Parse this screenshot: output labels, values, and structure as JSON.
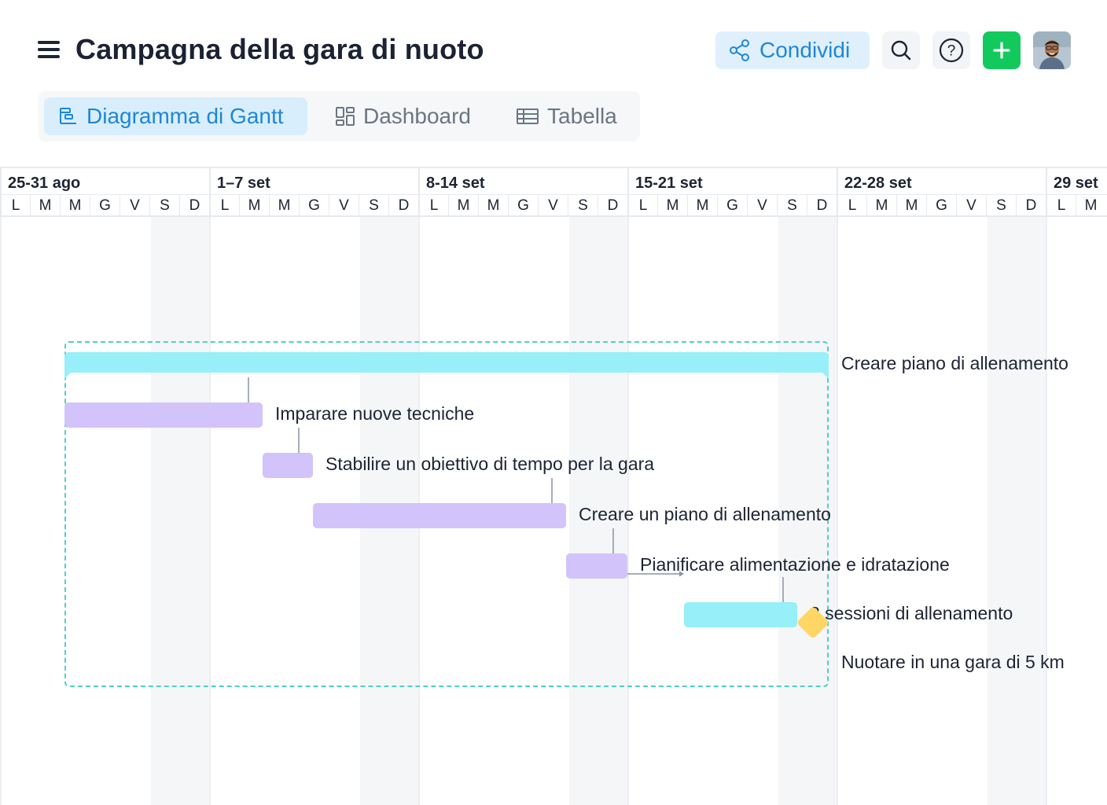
{
  "header": {
    "title": "Campagna della gara di nuoto",
    "share_label": "Condividi"
  },
  "tabs": [
    {
      "label": "Diagramma di Gantt",
      "active": true
    },
    {
      "label": "Dashboard",
      "active": false
    },
    {
      "label": "Tabella",
      "active": false
    }
  ],
  "timeline": {
    "weeks": [
      "25-31 ago",
      "1–7 set",
      "8-14 set",
      "15-21 set",
      "22-28 set",
      "29 set"
    ],
    "days": [
      "L",
      "M",
      "M",
      "G",
      "V",
      "S",
      "D",
      "L",
      "M",
      "M",
      "G",
      "V",
      "S",
      "D",
      "L",
      "M",
      "M",
      "G",
      "V",
      "S",
      "D",
      "L",
      "M",
      "M",
      "G",
      "V",
      "S",
      "D",
      "L",
      "M",
      "M",
      "G",
      "V",
      "S",
      "D",
      "L",
      "M"
    ]
  },
  "tasks": [
    {
      "label": "Creare piano di allenamento",
      "type": "summary",
      "color": "#97eff9"
    },
    {
      "label": "Imparare nuove tecniche",
      "type": "task",
      "color": "#d2c3fb"
    },
    {
      "label": "Stabilire un obiettivo di tempo per la gara",
      "type": "task",
      "color": "#d2c3fb"
    },
    {
      "label": "Creare un piano di allenamento",
      "type": "task",
      "color": "#d2c3fb"
    },
    {
      "label": "Pianificare alimentazione e idratazione",
      "type": "task",
      "color": "#d2c3fb"
    },
    {
      "label": "2 sessioni di allenamento",
      "type": "task",
      "color": "#97eff9"
    },
    {
      "label": "Nuotare in una gara di 5 km",
      "type": "milestone",
      "color": "#ffd666"
    }
  ],
  "colors": {
    "accent": "#1e87d8",
    "add_button": "#12c95e",
    "group_border": "#4fd1c5"
  },
  "icons": {
    "menu": "hamburger-menu-icon",
    "share": "share-icon",
    "search": "search-icon",
    "help": "help-icon",
    "add": "plus-icon",
    "gantt": "gantt-chart-icon",
    "dashboard": "dashboard-grid-icon",
    "table": "table-icon"
  }
}
